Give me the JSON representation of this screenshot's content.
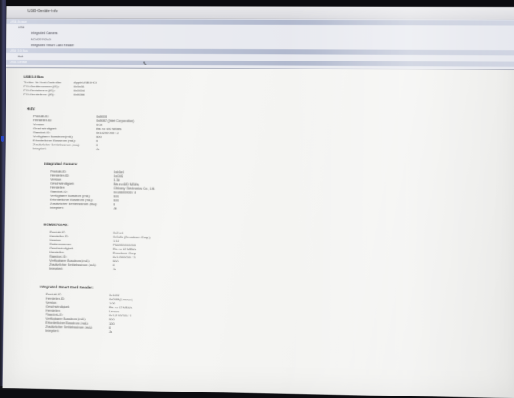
{
  "window": {
    "title": "USB-Geräte-Info"
  },
  "tree": [
    {
      "label": "USB-Busse",
      "bar": true
    },
    {
      "label": "USB",
      "bar": false
    },
    {
      "label": "Integrated Camera",
      "bar": false
    },
    {
      "label": "BCM20702A0",
      "bar": false
    },
    {
      "label": "Integrated Smart Card Reader",
      "bar": false
    },
    {
      "label": "USB 3.0 Bus",
      "bar": true
    },
    {
      "label": "Hub",
      "bar": false
    },
    {
      "label": "USB-Geräte",
      "bar": true
    }
  ],
  "bus": {
    "title": "USB 3.0 Bus:",
    "rows": [
      {
        "k": "Treiber für Host-Controller:",
        "v": "AppleUSBXHCI"
      },
      {
        "k": "PCI-Gerätenummer (ID):",
        "v": "0x9c31"
      },
      {
        "k": "PCI-Revisionsnr. (ID):",
        "v": "0x0004"
      },
      {
        "k": "PCI-Herstellernr. (ID):",
        "v": "0x8086"
      }
    ]
  },
  "devices": [
    {
      "name": "Hub:",
      "rows": [
        {
          "k": "Produkt-ID:",
          "v": "0x8000"
        },
        {
          "k": "Hersteller-ID:",
          "v": "0x8087  (Intel Corporation)"
        },
        {
          "k": "Version:",
          "v": "0.04"
        },
        {
          "k": "Geschwindigkeit:",
          "v": "Bis zu 480 MBit/s"
        },
        {
          "k": "Standort-ID:",
          "v": "0x14200000 / 2"
        },
        {
          "k": "Verfügbarer Busstrom (mA):",
          "v": "500"
        },
        {
          "k": "Erforderlicher Busstrom (mA):",
          "v": "0"
        },
        {
          "k": "Zusätzlicher Betriebsstrom (mA):",
          "v": "0"
        },
        {
          "k": "Integriert:",
          "v": "Ja"
        }
      ]
    },
    {
      "name": "Integrated Camera:",
      "rows": [
        {
          "k": "Produkt-ID:",
          "v": "0xb5e0"
        },
        {
          "k": "Hersteller-ID:",
          "v": "0x04f2"
        },
        {
          "k": "Version:",
          "v": "5.30"
        },
        {
          "k": "Geschwindigkeit:",
          "v": "Bis zu 480 MBit/s"
        },
        {
          "k": "Hersteller:",
          "v": "Chicony Electronics Co., Ltd."
        },
        {
          "k": "Standort-ID:",
          "v": "0x14600000 / 4"
        },
        {
          "k": "Verfügbarer Busstrom (mA):",
          "v": "500"
        },
        {
          "k": "Erforderlicher Busstrom (mA):",
          "v": "500"
        },
        {
          "k": "Zusätzlicher Betriebsstrom (mA):",
          "v": "0"
        },
        {
          "k": "Integriert:",
          "v": "Ja"
        }
      ]
    },
    {
      "name": "BCM20702A0:",
      "rows": [
        {
          "k": "Produkt-ID:",
          "v": "0x21e6"
        },
        {
          "k": "Hersteller-ID:",
          "v": "0x0a5c  (Broadcom Corp.)"
        },
        {
          "k": "Version:",
          "v": "1.12"
        },
        {
          "k": "Seriennummer:",
          "v": "F8A9D0000000"
        },
        {
          "k": "Geschwindigkeit:",
          "v": "Bis zu 12 MBit/s"
        },
        {
          "k": "Hersteller:",
          "v": "Broadcom Corp"
        },
        {
          "k": "Standort-ID:",
          "v": "0x14300000 / 3"
        },
        {
          "k": "Verfügbarer Busstrom (mA):",
          "v": "500"
        },
        {
          "k": "Zusätzlicher Betriebsstrom (mA):",
          "v": "0"
        },
        {
          "k": "Integriert:",
          "v": "Ja"
        }
      ]
    },
    {
      "name": "Integrated Smart Card Reader:",
      "rows": [
        {
          "k": "Produkt-ID:",
          "v": "0x1002"
        },
        {
          "k": "Hersteller-ID:",
          "v": "0x058f  (Lenovo)"
        },
        {
          "k": "Version:",
          "v": "1.00"
        },
        {
          "k": "Geschwindigkeit:",
          "v": "Bis zu 12 MBit/s"
        },
        {
          "k": "Hersteller:",
          "v": "Lenovo"
        },
        {
          "k": "Standort-ID:",
          "v": "0x14100000 / 1"
        },
        {
          "k": "Verfügbarer Busstrom (mA):",
          "v": "500"
        },
        {
          "k": "Erforderlicher Busstrom (mA):",
          "v": "100"
        },
        {
          "k": "Zusätzlicher Betriebsstrom (mA):",
          "v": "0"
        },
        {
          "k": "Integriert:",
          "v": "Ja"
        }
      ]
    }
  ],
  "colors": {
    "bezel": "#3d3f63",
    "screen": "#f3f3f1",
    "bar": "#aeb6cc",
    "indicator": "#2a48c8"
  }
}
